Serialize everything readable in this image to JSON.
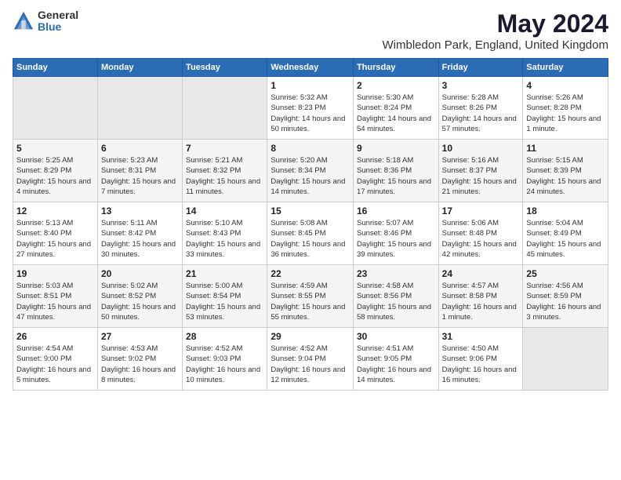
{
  "logo": {
    "general": "General",
    "blue": "Blue"
  },
  "title": {
    "month": "May 2024",
    "location": "Wimbledon Park, England, United Kingdom"
  },
  "weekdays": [
    "Sunday",
    "Monday",
    "Tuesday",
    "Wednesday",
    "Thursday",
    "Friday",
    "Saturday"
  ],
  "weeks": [
    [
      {
        "day": "",
        "info": ""
      },
      {
        "day": "",
        "info": ""
      },
      {
        "day": "",
        "info": ""
      },
      {
        "day": "1",
        "info": "Sunrise: 5:32 AM\nSunset: 8:23 PM\nDaylight: 14 hours\nand 50 minutes."
      },
      {
        "day": "2",
        "info": "Sunrise: 5:30 AM\nSunset: 8:24 PM\nDaylight: 14 hours\nand 54 minutes."
      },
      {
        "day": "3",
        "info": "Sunrise: 5:28 AM\nSunset: 8:26 PM\nDaylight: 14 hours\nand 57 minutes."
      },
      {
        "day": "4",
        "info": "Sunrise: 5:26 AM\nSunset: 8:28 PM\nDaylight: 15 hours\nand 1 minute."
      }
    ],
    [
      {
        "day": "5",
        "info": "Sunrise: 5:25 AM\nSunset: 8:29 PM\nDaylight: 15 hours\nand 4 minutes."
      },
      {
        "day": "6",
        "info": "Sunrise: 5:23 AM\nSunset: 8:31 PM\nDaylight: 15 hours\nand 7 minutes."
      },
      {
        "day": "7",
        "info": "Sunrise: 5:21 AM\nSunset: 8:32 PM\nDaylight: 15 hours\nand 11 minutes."
      },
      {
        "day": "8",
        "info": "Sunrise: 5:20 AM\nSunset: 8:34 PM\nDaylight: 15 hours\nand 14 minutes."
      },
      {
        "day": "9",
        "info": "Sunrise: 5:18 AM\nSunset: 8:36 PM\nDaylight: 15 hours\nand 17 minutes."
      },
      {
        "day": "10",
        "info": "Sunrise: 5:16 AM\nSunset: 8:37 PM\nDaylight: 15 hours\nand 21 minutes."
      },
      {
        "day": "11",
        "info": "Sunrise: 5:15 AM\nSunset: 8:39 PM\nDaylight: 15 hours\nand 24 minutes."
      }
    ],
    [
      {
        "day": "12",
        "info": "Sunrise: 5:13 AM\nSunset: 8:40 PM\nDaylight: 15 hours\nand 27 minutes."
      },
      {
        "day": "13",
        "info": "Sunrise: 5:11 AM\nSunset: 8:42 PM\nDaylight: 15 hours\nand 30 minutes."
      },
      {
        "day": "14",
        "info": "Sunrise: 5:10 AM\nSunset: 8:43 PM\nDaylight: 15 hours\nand 33 minutes."
      },
      {
        "day": "15",
        "info": "Sunrise: 5:08 AM\nSunset: 8:45 PM\nDaylight: 15 hours\nand 36 minutes."
      },
      {
        "day": "16",
        "info": "Sunrise: 5:07 AM\nSunset: 8:46 PM\nDaylight: 15 hours\nand 39 minutes."
      },
      {
        "day": "17",
        "info": "Sunrise: 5:06 AM\nSunset: 8:48 PM\nDaylight: 15 hours\nand 42 minutes."
      },
      {
        "day": "18",
        "info": "Sunrise: 5:04 AM\nSunset: 8:49 PM\nDaylight: 15 hours\nand 45 minutes."
      }
    ],
    [
      {
        "day": "19",
        "info": "Sunrise: 5:03 AM\nSunset: 8:51 PM\nDaylight: 15 hours\nand 47 minutes."
      },
      {
        "day": "20",
        "info": "Sunrise: 5:02 AM\nSunset: 8:52 PM\nDaylight: 15 hours\nand 50 minutes."
      },
      {
        "day": "21",
        "info": "Sunrise: 5:00 AM\nSunset: 8:54 PM\nDaylight: 15 hours\nand 53 minutes."
      },
      {
        "day": "22",
        "info": "Sunrise: 4:59 AM\nSunset: 8:55 PM\nDaylight: 15 hours\nand 55 minutes."
      },
      {
        "day": "23",
        "info": "Sunrise: 4:58 AM\nSunset: 8:56 PM\nDaylight: 15 hours\nand 58 minutes."
      },
      {
        "day": "24",
        "info": "Sunrise: 4:57 AM\nSunset: 8:58 PM\nDaylight: 16 hours\nand 1 minute."
      },
      {
        "day": "25",
        "info": "Sunrise: 4:56 AM\nSunset: 8:59 PM\nDaylight: 16 hours\nand 3 minutes."
      }
    ],
    [
      {
        "day": "26",
        "info": "Sunrise: 4:54 AM\nSunset: 9:00 PM\nDaylight: 16 hours\nand 5 minutes."
      },
      {
        "day": "27",
        "info": "Sunrise: 4:53 AM\nSunset: 9:02 PM\nDaylight: 16 hours\nand 8 minutes."
      },
      {
        "day": "28",
        "info": "Sunrise: 4:52 AM\nSunset: 9:03 PM\nDaylight: 16 hours\nand 10 minutes."
      },
      {
        "day": "29",
        "info": "Sunrise: 4:52 AM\nSunset: 9:04 PM\nDaylight: 16 hours\nand 12 minutes."
      },
      {
        "day": "30",
        "info": "Sunrise: 4:51 AM\nSunset: 9:05 PM\nDaylight: 16 hours\nand 14 minutes."
      },
      {
        "day": "31",
        "info": "Sunrise: 4:50 AM\nSunset: 9:06 PM\nDaylight: 16 hours\nand 16 minutes."
      },
      {
        "day": "",
        "info": ""
      }
    ]
  ]
}
